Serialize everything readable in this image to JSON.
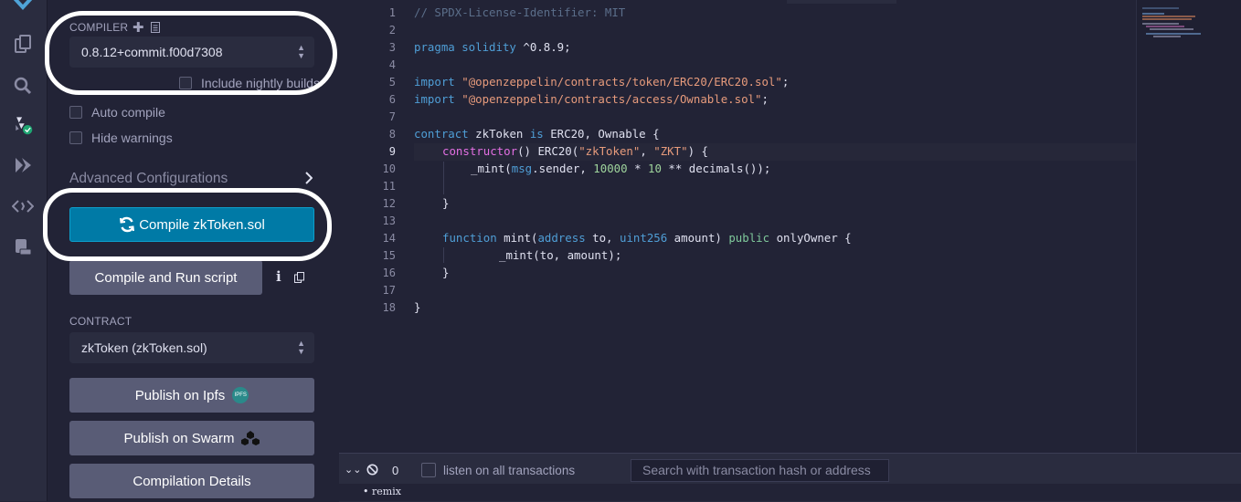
{
  "compiler": {
    "section_label": "COMPILER",
    "version_value": "0.8.12+commit.f00d7308",
    "include_nightly_label": "Include nightly builds",
    "auto_compile_label": "Auto compile",
    "hide_warnings_label": "Hide warnings",
    "advanced_label": "Advanced Configurations",
    "compile_button_label": "Compile zkToken.sol",
    "compile_run_label": "Compile and Run script"
  },
  "contract": {
    "section_label": "CONTRACT",
    "selected_value": "zkToken (zkToken.sol)",
    "publish_ipfs_label": "Publish on Ipfs",
    "ipfs_badge": "IPFS",
    "publish_swarm_label": "Publish on Swarm",
    "compilation_details_label": "Compilation Details"
  },
  "editor": {
    "line_numbers": [
      "1",
      "2",
      "3",
      "4",
      "5",
      "6",
      "7",
      "8",
      "9",
      "10",
      "11",
      "12",
      "13",
      "14",
      "15",
      "16",
      "17",
      "18"
    ],
    "code": {
      "l1": "// SPDX-License-Identifier: MIT",
      "l3_kw": "pragma solidity",
      "l3_rest": " ^0.8.9;",
      "l5_kw": "import",
      "l5_str": "\"@openzeppelin/contracts/token/ERC20/ERC20.sol\"",
      "l6_kw": "import",
      "l6_str": "\"@openzeppelin/contracts/access/Ownable.sol\"",
      "semi": ";",
      "l8_kw": "contract",
      "l8_name": " zkToken ",
      "l8_is": "is",
      "l8_rest": " ERC20, Ownable {",
      "l9_ctor": "constructor",
      "l9_a": "() ERC20(",
      "l9_s1": "\"zkToken\"",
      "l9_b": ", ",
      "l9_s2": "\"ZKT\"",
      "l9_c": ") {",
      "l10_a": "_mint(",
      "l10_msg": "msg",
      "l10_b": ".sender, ",
      "l10_n1": "10000",
      "l10_c": " * ",
      "l10_n2": "10",
      "l10_d": " ** decimals());",
      "l12": "}",
      "l14_fn": "function",
      "l14_a": " mint(",
      "l14_addr": "address",
      "l14_b": " to, ",
      "l14_uint": "uint256",
      "l14_c": " amount) ",
      "l14_pub": "public",
      "l14_d": " onlyOwner {",
      "l15": "_mint(to, amount);",
      "l16": "}",
      "l18": "}"
    }
  },
  "terminal": {
    "count": "0",
    "listen_label": "listen on all transactions",
    "search_placeholder": "Search with transaction hash or address",
    "output_item": "remix"
  },
  "colors": {
    "primary": "#007aa6",
    "secondary": "#595c76",
    "panel_bg": "#222336",
    "status_ok": "#1ea672"
  }
}
